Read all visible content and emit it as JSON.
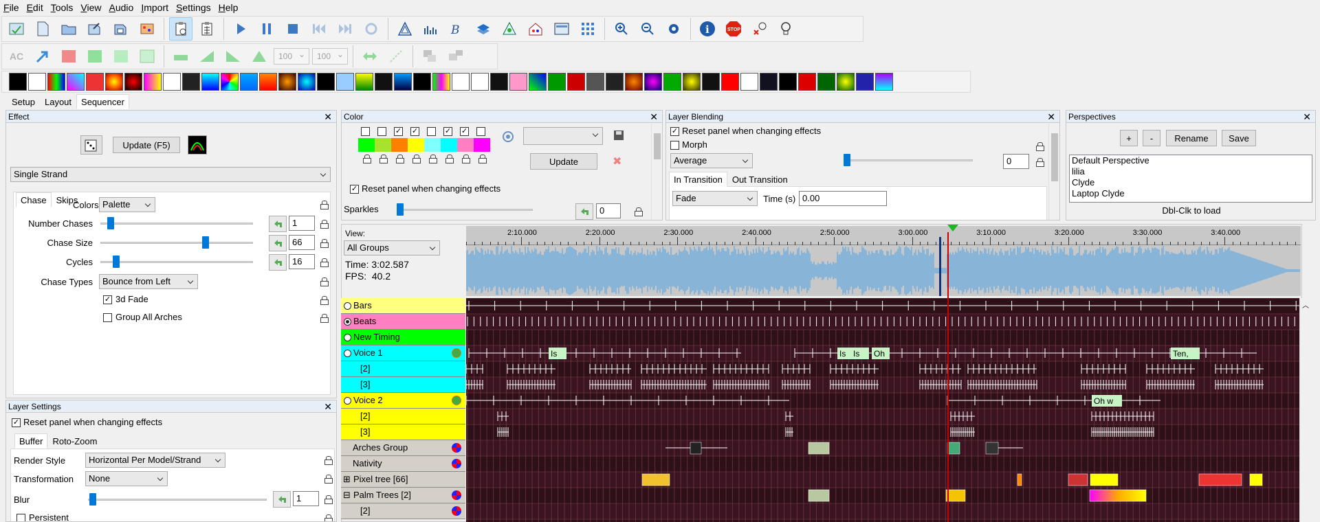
{
  "menu": [
    "File",
    "Edit",
    "Tools",
    "View",
    "Audio",
    "Import",
    "Settings",
    "Help"
  ],
  "toolbar": {
    "ac_label": "AC",
    "combo1": "100",
    "combo2": "100"
  },
  "main_tabs": [
    {
      "label": "Setup",
      "active": false
    },
    {
      "label": "Layout",
      "active": false
    },
    {
      "label": "Sequencer",
      "active": true
    }
  ],
  "effect_panel": {
    "title": "Effect",
    "update_label": "Update (F5)",
    "effect_type": "Single Strand",
    "tabs": [
      {
        "label": "Chase",
        "active": true
      },
      {
        "label": "Skips",
        "active": false
      }
    ],
    "colors_label": "Colors",
    "colors_value": "Palette",
    "number_chases_label": "Number Chases",
    "number_chases": "1",
    "chase_size_label": "Chase Size",
    "chase_size": "66",
    "cycles_label": "Cycles",
    "cycles": "16",
    "chase_types_label": "Chase Types",
    "chase_types_value": "Bounce from Left",
    "fade_label": "3d Fade",
    "group_arches_label": "Group All Arches"
  },
  "layer_settings": {
    "title": "Layer Settings",
    "reset_label": "Reset panel when changing effects",
    "tabs": [
      {
        "label": "Buffer",
        "active": true
      },
      {
        "label": "Roto-Zoom",
        "active": false
      }
    ],
    "render_style_label": "Render Style",
    "render_style": "Horizontal Per Model/Strand",
    "transformation_label": "Transformation",
    "transformation": "None",
    "blur_label": "Blur",
    "blur": "1",
    "persistent_label": "Persistent"
  },
  "color_panel": {
    "title": "Color",
    "swatches": [
      "#00ff00",
      "#a6e22e",
      "#ff8000",
      "#ffff00",
      "#80ffff",
      "#00ffff",
      "#ff80c0",
      "#ff00ff"
    ],
    "checked": [
      false,
      false,
      true,
      true,
      false,
      true,
      true,
      false
    ],
    "update_label": "Update",
    "reset_label": "Reset panel when changing effects",
    "sparkles_label": "Sparkles",
    "sparkles": "0"
  },
  "layer_blending": {
    "title": "Layer Blending",
    "reset_label": "Reset panel when changing effects",
    "morph_label": "Morph",
    "mode": "Average",
    "mode_value": "0",
    "tabs": [
      {
        "label": "In Transition",
        "active": true
      },
      {
        "label": "Out Transition",
        "active": false
      }
    ],
    "transition": "Fade",
    "time_label": "Time (s)",
    "time_value": "0.00"
  },
  "perspectives": {
    "title": "Perspectives",
    "plus_label": "+",
    "minus_label": "-",
    "rename_label": "Rename",
    "save_label": "Save",
    "items": [
      "Default Perspective",
      "lilia",
      "Clyde",
      "Laptop Clyde"
    ],
    "hint": "Dbl-Clk to load"
  },
  "sequencer": {
    "view_label": "View:",
    "view_value": "All Groups",
    "time_text": "Time: 3:02.587",
    "fps_text": "FPS:  40.2",
    "timeline_labels": [
      "2:10.000",
      "2:20.000",
      "2:30.000",
      "2:40.000",
      "2:50.000",
      "3:00.000",
      "3:10.000",
      "3:20.000",
      "3:30.000",
      "3:40.000"
    ],
    "rows": [
      {
        "label": "Bars",
        "color": "#ffff80",
        "radio": true
      },
      {
        "label": "Beats",
        "color": "#ff80c0",
        "radio": true,
        "selected": true
      },
      {
        "label": "New Timing",
        "color": "#00ff00",
        "radio": true
      },
      {
        "label": "Voice 1",
        "color": "#00ffff",
        "radio": true,
        "icon": "voice"
      },
      {
        "label": "[2]",
        "color": "#00ffff",
        "indent": true
      },
      {
        "label": "[3]",
        "color": "#00ffff",
        "indent": true
      },
      {
        "label": "Voice 2",
        "color": "#ffff00",
        "radio": true,
        "icon": "voice"
      },
      {
        "label": "[2]",
        "color": "#ffff00",
        "indent": true
      },
      {
        "label": "[3]",
        "color": "#ffff00",
        "indent": true
      },
      {
        "label": "Arches Group",
        "color": "#d4d0c8",
        "icon": "group"
      },
      {
        "label": "Nativity",
        "color": "#d4d0c8",
        "icon": "group"
      },
      {
        "label": "Pixel tree [66]",
        "color": "#d4d0c8",
        "expander": "⊞"
      },
      {
        "label": "Palm Trees [2]",
        "color": "#d4d0c8",
        "expander": "⊟",
        "icon": "group"
      },
      {
        "label": "[2]",
        "color": "#d4d0c8",
        "indent": true,
        "icon": "group"
      }
    ],
    "voice1_labels": [
      "Ten,",
      "Is",
      "Oh"
    ],
    "voice2_labels": [
      "Oh w"
    ]
  }
}
